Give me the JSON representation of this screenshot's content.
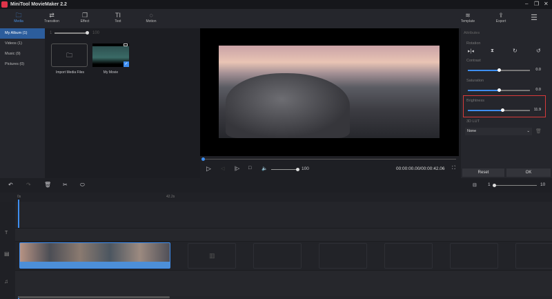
{
  "app": {
    "title": "MiniTool MovieMaker 2.2"
  },
  "toolbar": {
    "items": [
      {
        "label": "Media",
        "icon": "folder-icon",
        "active": true
      },
      {
        "label": "Transition",
        "icon": "transition-icon"
      },
      {
        "label": "Effect",
        "icon": "effect-icon"
      },
      {
        "label": "Text",
        "icon": "text-icon"
      },
      {
        "label": "Motion",
        "icon": "motion-icon"
      }
    ],
    "template": "Template",
    "export": "Export"
  },
  "sidebar": {
    "items": [
      "My Album (1)",
      "Videos (1)",
      "Music (9)",
      "Pictures (0)"
    ]
  },
  "media": {
    "zoom_min": "1",
    "zoom_max": "100",
    "import_label": "Import Media Files",
    "clip_label": "My Movie"
  },
  "player": {
    "volume": "100",
    "time": "00:00:00.00/00:00:42.06"
  },
  "attributes": {
    "title": "Attributes",
    "rotation": "Rotation",
    "contrast": {
      "label": "Contrast",
      "value": "0.0",
      "level": 0.5
    },
    "saturation": {
      "label": "Saturation",
      "value": "0.0",
      "level": 0.5
    },
    "brightness": {
      "label": "Brightness",
      "value": "11.9",
      "level": 0.56
    },
    "lut": {
      "label": "3D LUT",
      "value": "None"
    },
    "reset": "Reset",
    "ok": "OK"
  },
  "timeline": {
    "zoom_min": "1",
    "zoom_max": "10",
    "ruler": [
      "0s",
      "42.2s"
    ]
  },
  "colors": {
    "accent": "#3e8ef0",
    "highlight": "#e0344a"
  }
}
